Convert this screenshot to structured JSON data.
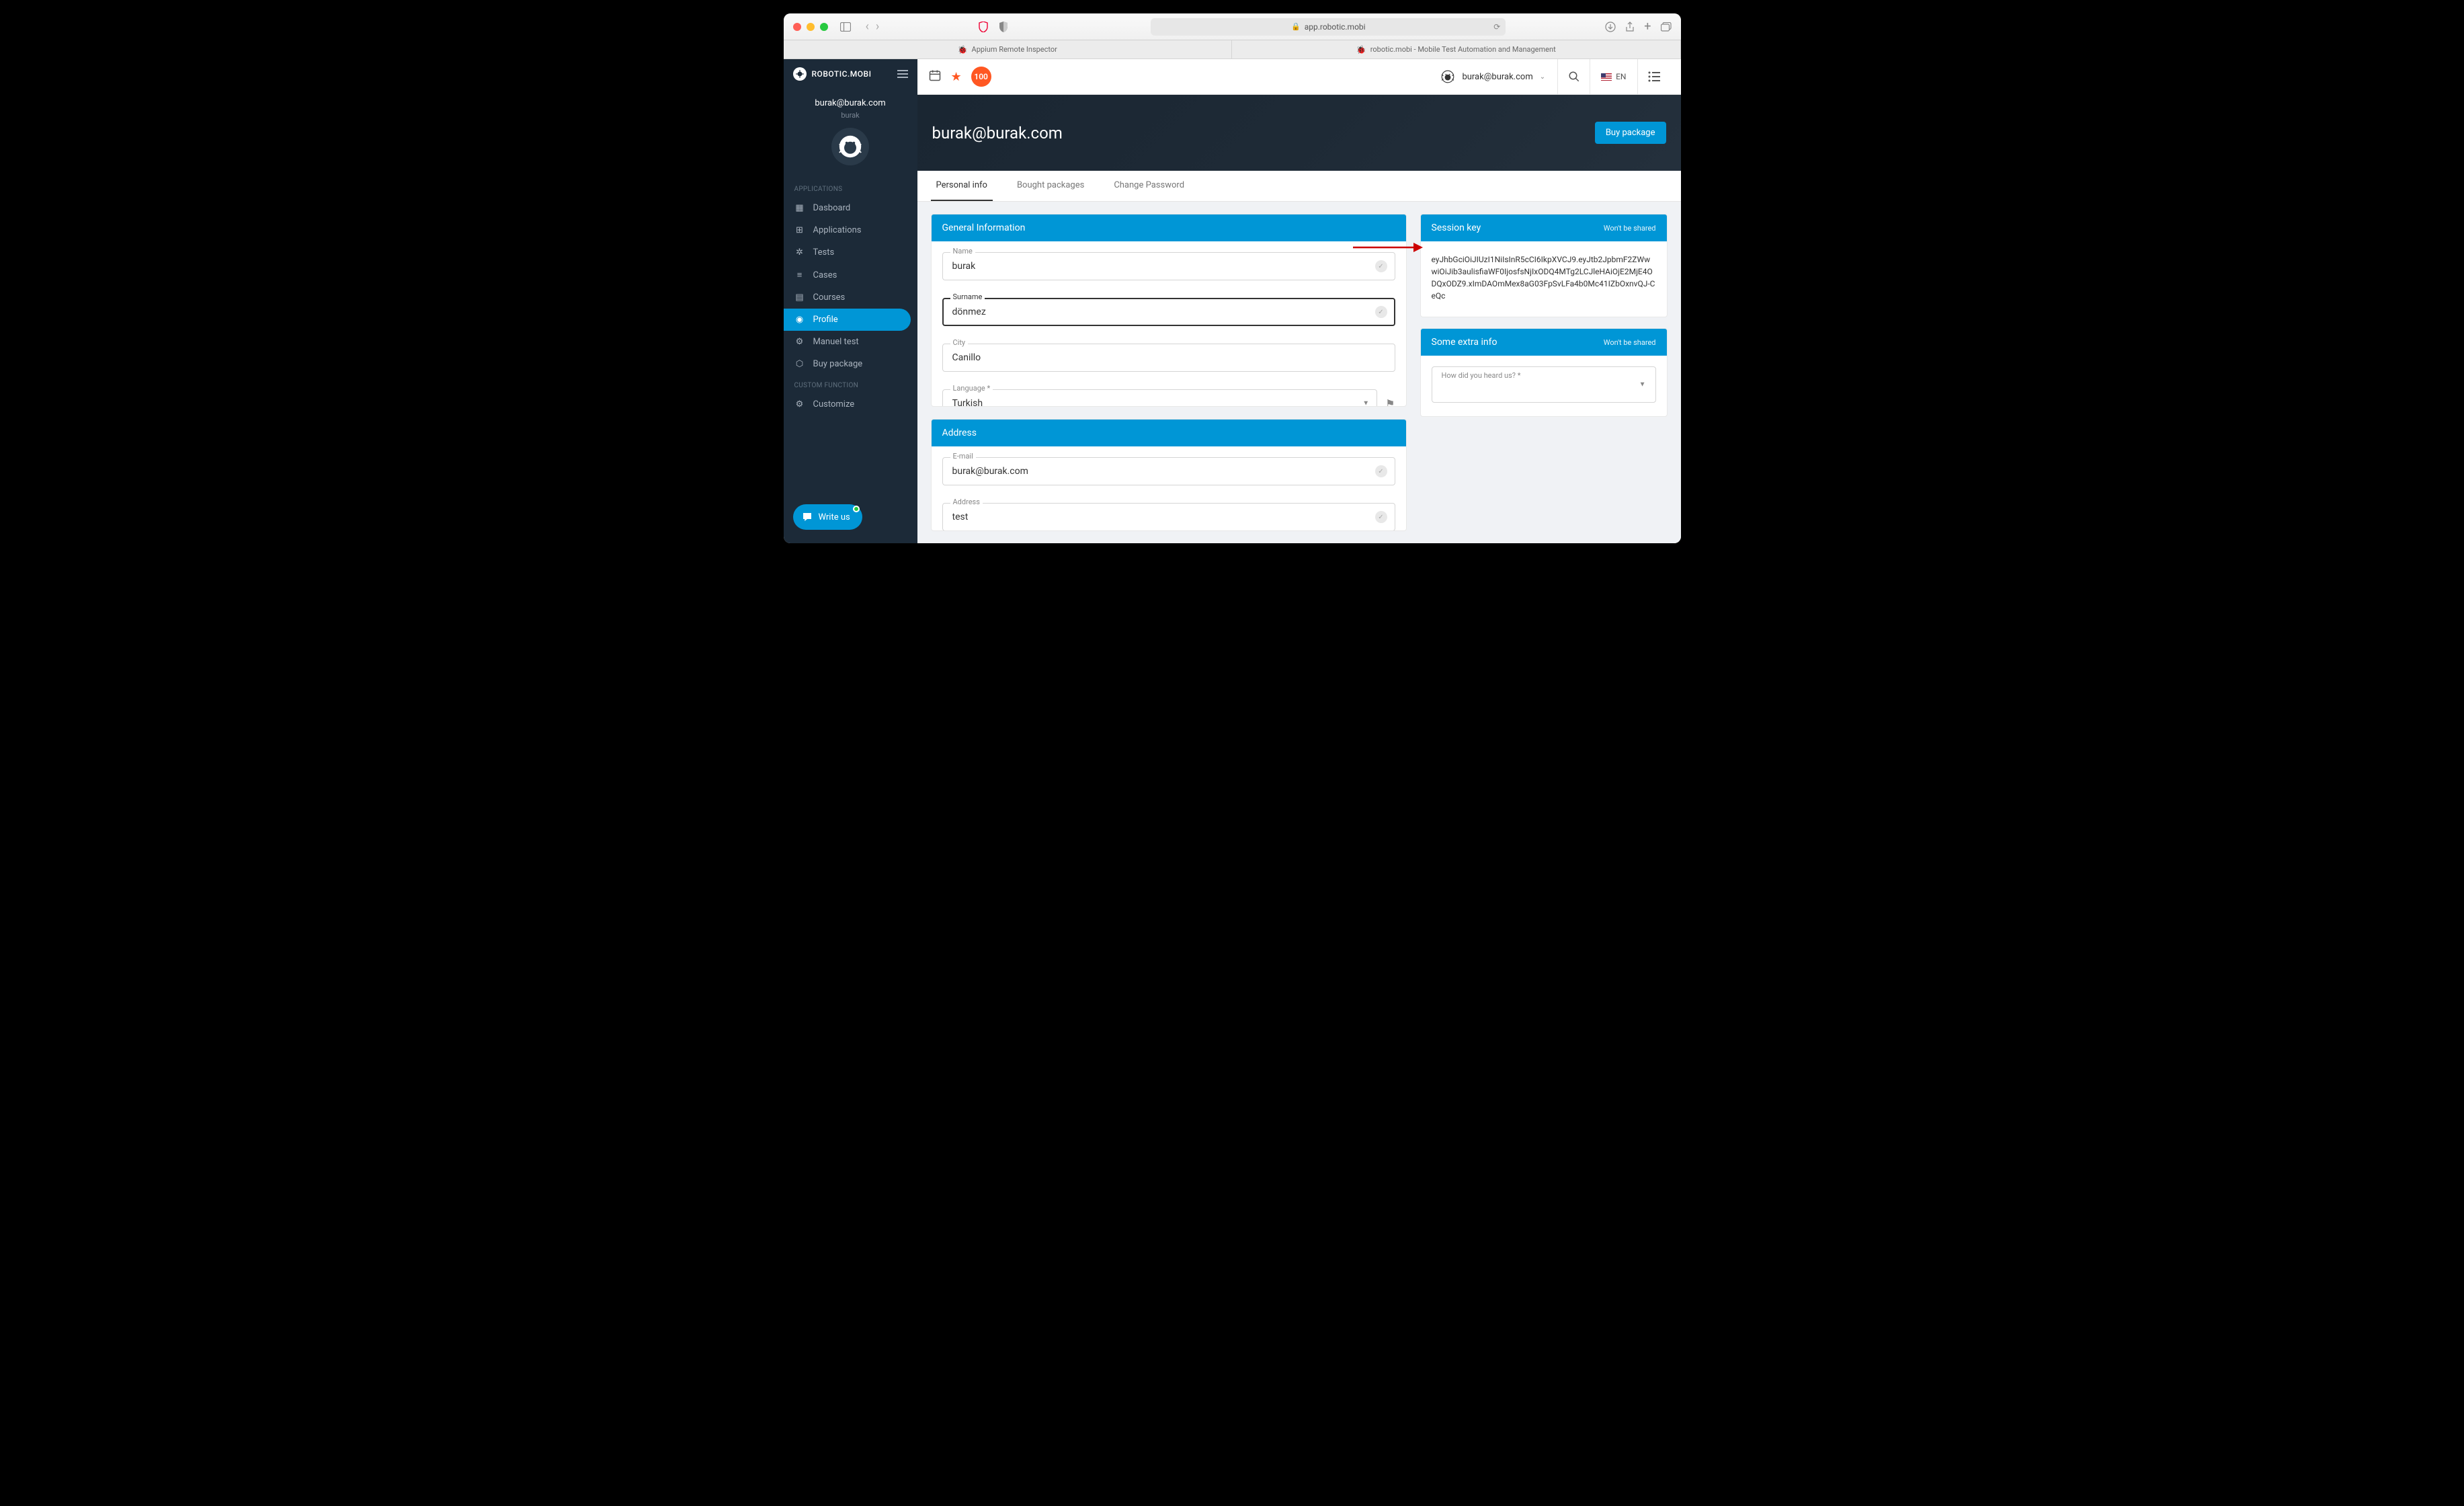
{
  "browser": {
    "url": "app.robotic.mobi",
    "tabs": [
      {
        "label": "Appium Remote Inspector"
      },
      {
        "label": "robotic.mobi - Mobile Test Automation and Management"
      }
    ]
  },
  "sidebar": {
    "brand": "ROBOTIC.MOBI",
    "user_email": "burak@burak.com",
    "user_name": "burak",
    "sections": {
      "applications": {
        "label": "APPLICATIONS",
        "items": [
          {
            "label": "Dasboard"
          },
          {
            "label": "Applications"
          },
          {
            "label": "Tests"
          },
          {
            "label": "Cases"
          },
          {
            "label": "Courses"
          },
          {
            "label": "Profile"
          },
          {
            "label": "Manuel test"
          },
          {
            "label": "Buy package"
          }
        ]
      },
      "custom": {
        "label": "CUSTOM FUNCTION",
        "items": [
          {
            "label": "Customize"
          }
        ]
      }
    },
    "chat_label": "Write us"
  },
  "topbar": {
    "badge": "100",
    "user_email": "burak@burak.com",
    "lang": "EN"
  },
  "hero": {
    "title": "burak@burak.com",
    "buy_label": "Buy package"
  },
  "tabs": [
    {
      "label": "Personal info"
    },
    {
      "label": "Bought packages"
    },
    {
      "label": "Change Password"
    }
  ],
  "general": {
    "header": "General Information",
    "fields": {
      "name_label": "Name",
      "name_value": "burak",
      "surname_label": "Surname",
      "surname_value": "dönmez",
      "city_label": "City",
      "city_value": "Canillo",
      "language_label": "Language *",
      "language_value": "Turkish"
    }
  },
  "address": {
    "header": "Address",
    "fields": {
      "email_label": "E-mail",
      "email_value": "burak@burak.com",
      "address_label": "Address",
      "address_value": "test"
    }
  },
  "session": {
    "header": "Session key",
    "note": "Won't be shared",
    "value": "eyJhbGciOiJIUzI1NiIsInR5cCI6IkpXVCJ9.eyJtb2JpbmF2ZWwwiOiJib3aulisfiaWF0IjosfsNjIxODQ4MTg2LCJleHAiOjE2MjE4ODQxODZ9.xImDAOmMex8aG03FpSvLFa4b0Mc41IZbOxnvQJ-CeQc"
  },
  "extra": {
    "header": "Some extra info",
    "note": "Won't be shared",
    "heard_label": "How did you heard us? *"
  }
}
